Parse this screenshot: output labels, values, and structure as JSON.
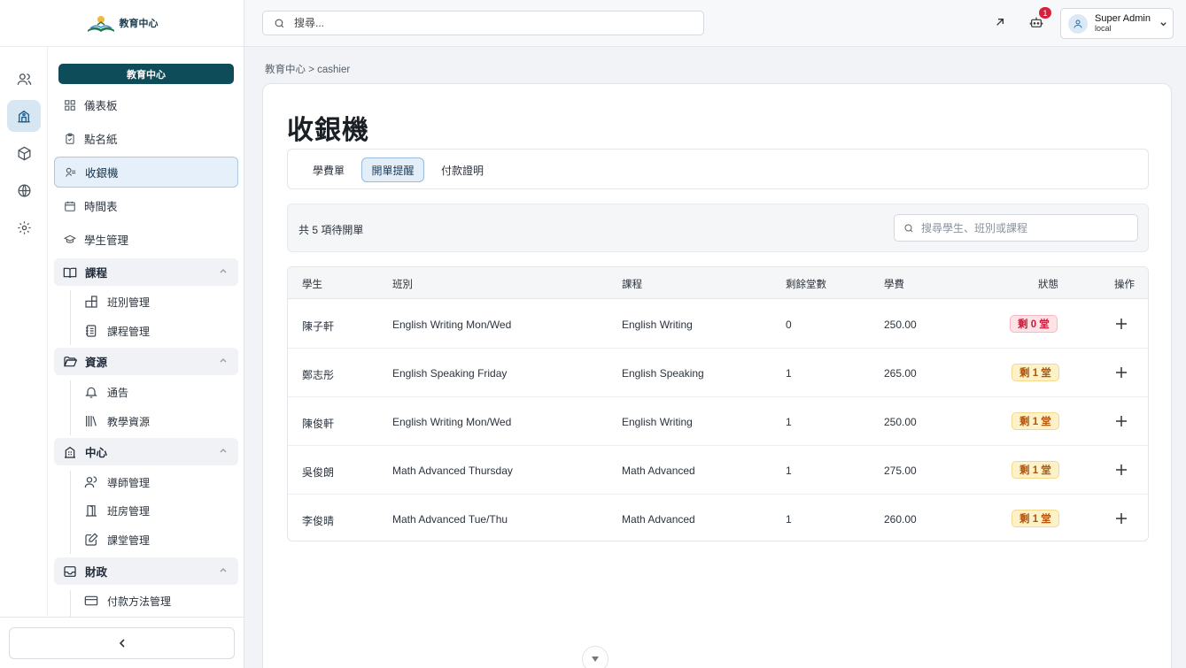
{
  "brand": {
    "logo_text": "教育中心",
    "pill_label": "教育中心"
  },
  "topbar": {
    "search_placeholder": "搜尋...",
    "notification_count": "1",
    "user_name": "Super Admin",
    "user_sub": "local"
  },
  "nav": {
    "items": [
      {
        "label": "儀表板",
        "icon": "dashboard-icon"
      },
      {
        "label": "點名紙",
        "icon": "clipboard-check-icon"
      },
      {
        "label": "收銀機",
        "icon": "cashier-icon"
      },
      {
        "label": "時間表",
        "icon": "calendar-icon"
      },
      {
        "label": "學生管理",
        "icon": "graduation-cap-icon"
      }
    ],
    "groups": [
      {
        "label": "課程",
        "icon": "book-open-icon",
        "items": [
          {
            "label": "班別管理",
            "icon": "blocks-icon"
          },
          {
            "label": "課程管理",
            "icon": "notebook-icon"
          }
        ]
      },
      {
        "label": "資源",
        "icon": "folder-open-icon",
        "items": [
          {
            "label": "通告",
            "icon": "bell-icon"
          },
          {
            "label": "教學資源",
            "icon": "library-icon"
          }
        ]
      },
      {
        "label": "中心",
        "icon": "building-icon",
        "items": [
          {
            "label": "導師管理",
            "icon": "user-icon"
          },
          {
            "label": "班房管理",
            "icon": "door-icon"
          },
          {
            "label": "課堂管理",
            "icon": "edit-square-icon"
          }
        ]
      },
      {
        "label": "財政",
        "icon": "inbox-icon",
        "items": [
          {
            "label": "付款方法管理",
            "icon": "credit-card-icon"
          }
        ]
      }
    ]
  },
  "breadcrumb": {
    "root": "教育中心",
    "separator": ">",
    "current": "cashier"
  },
  "page": {
    "title": "收銀機"
  },
  "tabs": [
    {
      "label": "學費單",
      "active": false
    },
    {
      "label": "開單提醒",
      "active": true
    },
    {
      "label": "付款證明",
      "active": false
    }
  ],
  "filter": {
    "count_text": "共 5 項待開單",
    "search_placeholder": "搜尋學生、班別或課程"
  },
  "table": {
    "headers": [
      "學生",
      "班別",
      "課程",
      "剩餘堂數",
      "學費",
      "狀態",
      "操作"
    ],
    "rows": [
      {
        "student": "陳子軒",
        "class": "English Writing Mon/Wed",
        "course": "English Writing",
        "remaining": "0",
        "fee": "250.00",
        "status": "剩 0 堂"
      },
      {
        "student": "鄭志彤",
        "class": "English Speaking Friday",
        "course": "English Speaking",
        "remaining": "1",
        "fee": "265.00",
        "status": "剩 1 堂"
      },
      {
        "student": "陳俊軒",
        "class": "English Writing Mon/Wed",
        "course": "English Writing",
        "remaining": "1",
        "fee": "250.00",
        "status": "剩 1 堂"
      },
      {
        "student": "吳俊朗",
        "class": "Math Advanced Thursday",
        "course": "Math Advanced",
        "remaining": "1",
        "fee": "275.00",
        "status": "剩 1 堂"
      },
      {
        "student": "李俊晴",
        "class": "Math Advanced Tue/Thu",
        "course": "Math Advanced",
        "remaining": "1",
        "fee": "260.00",
        "status": "剩 1 堂"
      }
    ]
  },
  "colors": {
    "brand": "#0f4c59",
    "status_zero_bg": "#fde2e6",
    "status_zero_fg": "#c8193a",
    "status_one_bg": "#fdf1c7",
    "status_one_fg": "#b4530a"
  }
}
